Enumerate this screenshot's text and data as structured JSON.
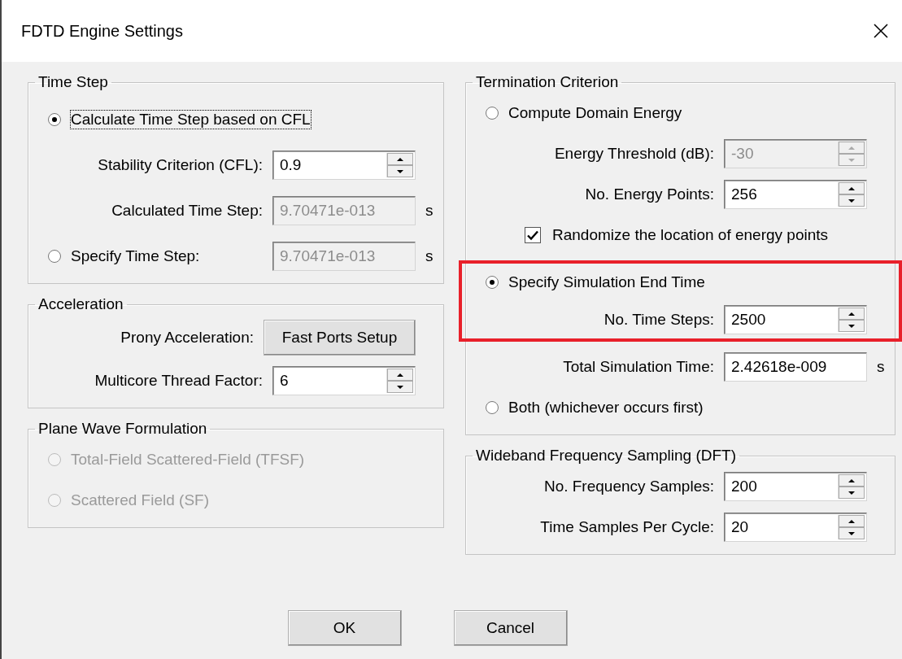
{
  "window": {
    "title": "FDTD Engine Settings"
  },
  "left_column": {
    "sections": [
      {
        "title": "Time Step",
        "disabled": false,
        "rows": [
          {
            "kind": "radio",
            "label": "Calculate Time Step based on CFL",
            "selected": true,
            "focused": true,
            "disabled": false
          },
          {
            "kind": "field",
            "label": "Stability Criterion (CFL):",
            "value": "0.9",
            "spinner": true,
            "disabled": false
          },
          {
            "kind": "field",
            "label": "Calculated Time Step:",
            "value": "9.70471e-013",
            "spinner": false,
            "disabled": true,
            "unit": "s"
          },
          {
            "kind": "radio-field",
            "label": "Specify Time Step:",
            "selected": false,
            "value": "9.70471e-013",
            "disabled": true,
            "unit": "s"
          }
        ]
      },
      {
        "title": "Acceleration",
        "disabled": false,
        "rows": [
          {
            "kind": "button-field",
            "label": "Prony Acceleration:",
            "button": "Fast Ports Setup"
          },
          {
            "kind": "field",
            "label": "Multicore Thread Factor:",
            "value": "6",
            "spinner": true,
            "disabled": false
          }
        ]
      },
      {
        "title": "Plane Wave Formulation",
        "disabled": false,
        "rows": [
          {
            "kind": "radio",
            "label": "Total-Field Scattered-Field (TFSF)",
            "selected": false,
            "focused": false,
            "disabled": true
          },
          {
            "kind": "radio",
            "label": "Scattered Field (SF)",
            "selected": false,
            "focused": false,
            "disabled": true
          }
        ]
      }
    ]
  },
  "right_column": {
    "sections": [
      {
        "title": "Termination Criterion",
        "disabled": false,
        "rows": [
          {
            "kind": "radio",
            "label": "Compute Domain Energy",
            "selected": false,
            "focused": false,
            "disabled": false
          },
          {
            "kind": "field",
            "label": "Energy Threshold (dB):",
            "value": "-30",
            "spinner": true,
            "disabled": true
          },
          {
            "kind": "field",
            "label": "No. Energy Points:",
            "value": "256",
            "spinner": true,
            "disabled": false
          },
          {
            "kind": "checkbox",
            "label": "Randomize the location of energy points",
            "checked": true
          },
          {
            "kind": "group",
            "highlighted": true,
            "rows": [
              {
                "kind": "radio",
                "label": "Specify Simulation End Time",
                "selected": true,
                "focused": false,
                "disabled": false
              },
              {
                "kind": "field",
                "label": "No. Time Steps:",
                "value": "2500",
                "spinner": true,
                "disabled": false
              }
            ]
          },
          {
            "kind": "field",
            "label": "Total Simulation Time:",
            "value": "2.42618e-009",
            "spinner": false,
            "disabled": false,
            "unit": "s"
          },
          {
            "kind": "radio",
            "label": "Both (whichever occurs first)",
            "selected": false,
            "focused": false,
            "disabled": false
          }
        ]
      },
      {
        "title": "Wideband Frequency Sampling (DFT)",
        "disabled": false,
        "rows": [
          {
            "kind": "field",
            "label": "No. Frequency Samples:",
            "value": "200",
            "spinner": true,
            "disabled": false
          },
          {
            "kind": "field",
            "label": "Time Samples Per Cycle:",
            "value": "20",
            "spinner": true,
            "disabled": false
          }
        ]
      }
    ]
  },
  "buttons": [
    {
      "label": "OK"
    },
    {
      "label": "Cancel"
    }
  ]
}
